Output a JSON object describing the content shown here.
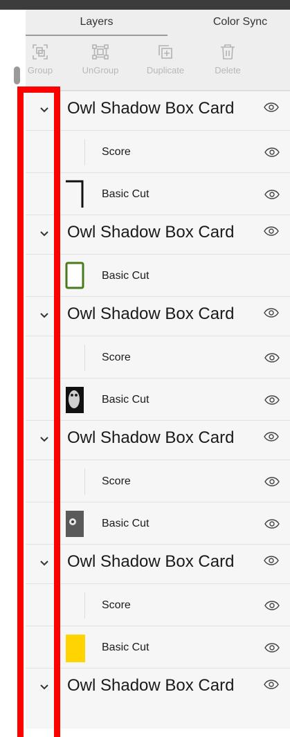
{
  "tabs": [
    {
      "label": "Layers",
      "active": true
    },
    {
      "label": "Color Sync",
      "active": false
    }
  ],
  "toolbar": [
    {
      "label": "Group",
      "icon": "group-icon"
    },
    {
      "label": "UnGroup",
      "icon": "ungroup-icon"
    },
    {
      "label": "Duplicate",
      "icon": "duplicate-icon"
    },
    {
      "label": "Delete",
      "icon": "delete-icon"
    }
  ],
  "layers": [
    {
      "title": "Owl Shadow Box Card",
      "children": [
        {
          "label": "Score",
          "thumb": "none",
          "eye": true
        },
        {
          "label": "Basic Cut",
          "thumb": "black-frame",
          "eye": true
        }
      ]
    },
    {
      "title": "Owl Shadow Box Card",
      "children": [
        {
          "label": "Basic Cut",
          "thumb": "green-frame",
          "eye": false
        }
      ]
    },
    {
      "title": "Owl Shadow Box Card",
      "children": [
        {
          "label": "Score",
          "thumb": "none",
          "eye": true
        },
        {
          "label": "Basic Cut",
          "thumb": "owl-bw",
          "eye": true
        }
      ]
    },
    {
      "title": "Owl Shadow Box Card",
      "children": [
        {
          "label": "Score",
          "thumb": "none",
          "eye": true
        },
        {
          "label": "Basic Cut",
          "thumb": "owl-gray",
          "eye": true
        }
      ]
    },
    {
      "title": "Owl Shadow Box Card",
      "children": [
        {
          "label": "Score",
          "thumb": "none",
          "eye": true
        },
        {
          "label": "Basic Cut",
          "thumb": "yellow",
          "eye": true
        }
      ]
    },
    {
      "title": "Owl Shadow Box Card",
      "children": []
    }
  ],
  "colors": {
    "highlight": "#ff0000",
    "yellow_thumb": "#ffd400",
    "green_thumb": "#4a7a1e"
  }
}
